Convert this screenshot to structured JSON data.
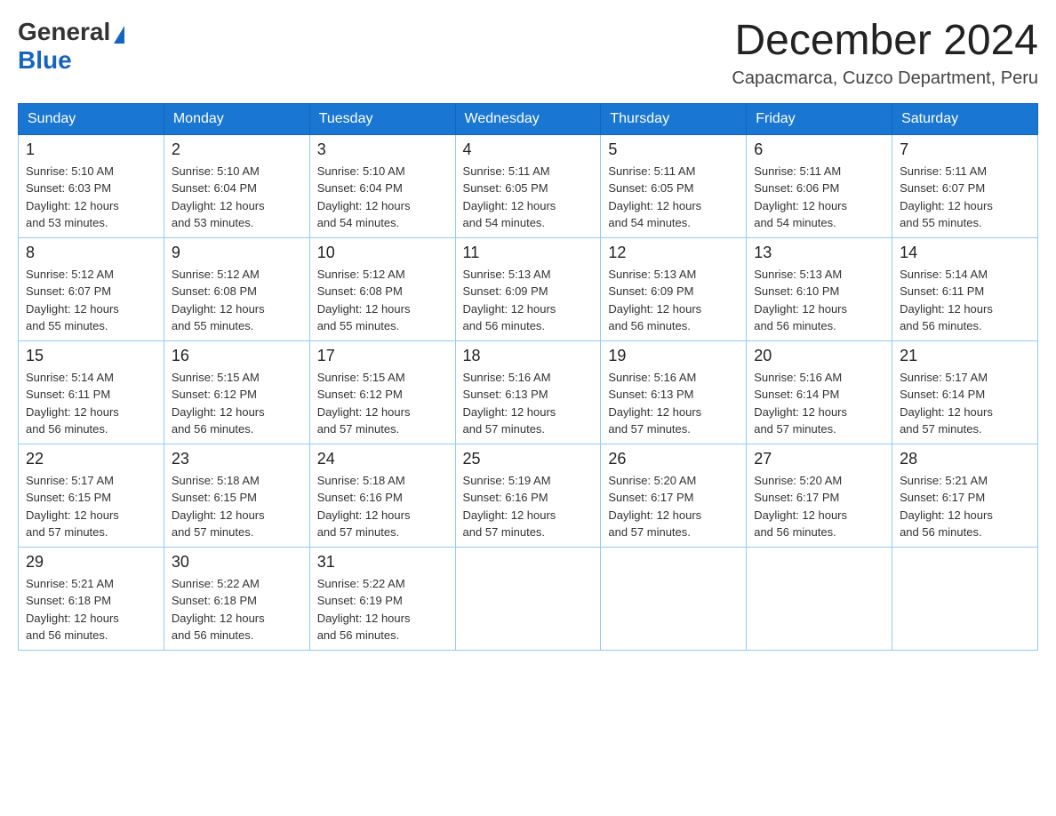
{
  "header": {
    "title": "December 2024",
    "subtitle": "Capacmarca, Cuzco Department, Peru",
    "logo_general": "General",
    "logo_blue": "Blue"
  },
  "calendar": {
    "days_of_week": [
      "Sunday",
      "Monday",
      "Tuesday",
      "Wednesday",
      "Thursday",
      "Friday",
      "Saturday"
    ],
    "weeks": [
      [
        {
          "day": "1",
          "sunrise": "5:10 AM",
          "sunset": "6:03 PM",
          "daylight": "12 hours and 53 minutes."
        },
        {
          "day": "2",
          "sunrise": "5:10 AM",
          "sunset": "6:04 PM",
          "daylight": "12 hours and 53 minutes."
        },
        {
          "day": "3",
          "sunrise": "5:10 AM",
          "sunset": "6:04 PM",
          "daylight": "12 hours and 54 minutes."
        },
        {
          "day": "4",
          "sunrise": "5:11 AM",
          "sunset": "6:05 PM",
          "daylight": "12 hours and 54 minutes."
        },
        {
          "day": "5",
          "sunrise": "5:11 AM",
          "sunset": "6:05 PM",
          "daylight": "12 hours and 54 minutes."
        },
        {
          "day": "6",
          "sunrise": "5:11 AM",
          "sunset": "6:06 PM",
          "daylight": "12 hours and 54 minutes."
        },
        {
          "day": "7",
          "sunrise": "5:11 AM",
          "sunset": "6:07 PM",
          "daylight": "12 hours and 55 minutes."
        }
      ],
      [
        {
          "day": "8",
          "sunrise": "5:12 AM",
          "sunset": "6:07 PM",
          "daylight": "12 hours and 55 minutes."
        },
        {
          "day": "9",
          "sunrise": "5:12 AM",
          "sunset": "6:08 PM",
          "daylight": "12 hours and 55 minutes."
        },
        {
          "day": "10",
          "sunrise": "5:12 AM",
          "sunset": "6:08 PM",
          "daylight": "12 hours and 55 minutes."
        },
        {
          "day": "11",
          "sunrise": "5:13 AM",
          "sunset": "6:09 PM",
          "daylight": "12 hours and 56 minutes."
        },
        {
          "day": "12",
          "sunrise": "5:13 AM",
          "sunset": "6:09 PM",
          "daylight": "12 hours and 56 minutes."
        },
        {
          "day": "13",
          "sunrise": "5:13 AM",
          "sunset": "6:10 PM",
          "daylight": "12 hours and 56 minutes."
        },
        {
          "day": "14",
          "sunrise": "5:14 AM",
          "sunset": "6:11 PM",
          "daylight": "12 hours and 56 minutes."
        }
      ],
      [
        {
          "day": "15",
          "sunrise": "5:14 AM",
          "sunset": "6:11 PM",
          "daylight": "12 hours and 56 minutes."
        },
        {
          "day": "16",
          "sunrise": "5:15 AM",
          "sunset": "6:12 PM",
          "daylight": "12 hours and 56 minutes."
        },
        {
          "day": "17",
          "sunrise": "5:15 AM",
          "sunset": "6:12 PM",
          "daylight": "12 hours and 57 minutes."
        },
        {
          "day": "18",
          "sunrise": "5:16 AM",
          "sunset": "6:13 PM",
          "daylight": "12 hours and 57 minutes."
        },
        {
          "day": "19",
          "sunrise": "5:16 AM",
          "sunset": "6:13 PM",
          "daylight": "12 hours and 57 minutes."
        },
        {
          "day": "20",
          "sunrise": "5:16 AM",
          "sunset": "6:14 PM",
          "daylight": "12 hours and 57 minutes."
        },
        {
          "day": "21",
          "sunrise": "5:17 AM",
          "sunset": "6:14 PM",
          "daylight": "12 hours and 57 minutes."
        }
      ],
      [
        {
          "day": "22",
          "sunrise": "5:17 AM",
          "sunset": "6:15 PM",
          "daylight": "12 hours and 57 minutes."
        },
        {
          "day": "23",
          "sunrise": "5:18 AM",
          "sunset": "6:15 PM",
          "daylight": "12 hours and 57 minutes."
        },
        {
          "day": "24",
          "sunrise": "5:18 AM",
          "sunset": "6:16 PM",
          "daylight": "12 hours and 57 minutes."
        },
        {
          "day": "25",
          "sunrise": "5:19 AM",
          "sunset": "6:16 PM",
          "daylight": "12 hours and 57 minutes."
        },
        {
          "day": "26",
          "sunrise": "5:20 AM",
          "sunset": "6:17 PM",
          "daylight": "12 hours and 57 minutes."
        },
        {
          "day": "27",
          "sunrise": "5:20 AM",
          "sunset": "6:17 PM",
          "daylight": "12 hours and 56 minutes."
        },
        {
          "day": "28",
          "sunrise": "5:21 AM",
          "sunset": "6:17 PM",
          "daylight": "12 hours and 56 minutes."
        }
      ],
      [
        {
          "day": "29",
          "sunrise": "5:21 AM",
          "sunset": "6:18 PM",
          "daylight": "12 hours and 56 minutes."
        },
        {
          "day": "30",
          "sunrise": "5:22 AM",
          "sunset": "6:18 PM",
          "daylight": "12 hours and 56 minutes."
        },
        {
          "day": "31",
          "sunrise": "5:22 AM",
          "sunset": "6:19 PM",
          "daylight": "12 hours and 56 minutes."
        },
        null,
        null,
        null,
        null
      ]
    ],
    "labels": {
      "sunrise": "Sunrise:",
      "sunset": "Sunset:",
      "daylight": "Daylight:"
    }
  }
}
